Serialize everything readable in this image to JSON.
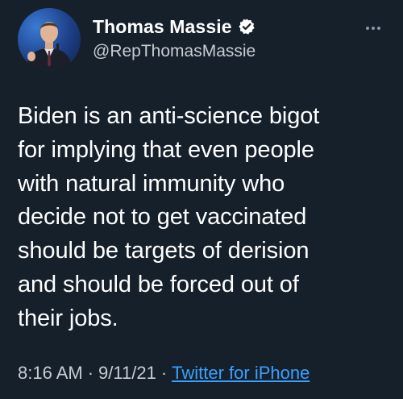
{
  "user": {
    "display_name": "Thomas Massie",
    "handle": "@RepThomasMassie",
    "verified": true,
    "avatar": "portrait-photo"
  },
  "tweet": {
    "text": "Biden is an anti-science bigot\nfor implying that even people\nwith natural immunity who\ndecide not to get vaccinated\nshould be targets of derision\nand should be forced out of\ntheir jobs.",
    "time": "8:16 AM",
    "date": "9/11/21",
    "separator": "·",
    "source": "Twitter for iPhone"
  },
  "icons": {
    "verified": "verified-badge-icon",
    "more": "more-options-icon"
  },
  "colors": {
    "background": "#15202b",
    "text": "#ffffff",
    "secondary_text": "#c7ccd1",
    "link": "#3aa0ff"
  }
}
